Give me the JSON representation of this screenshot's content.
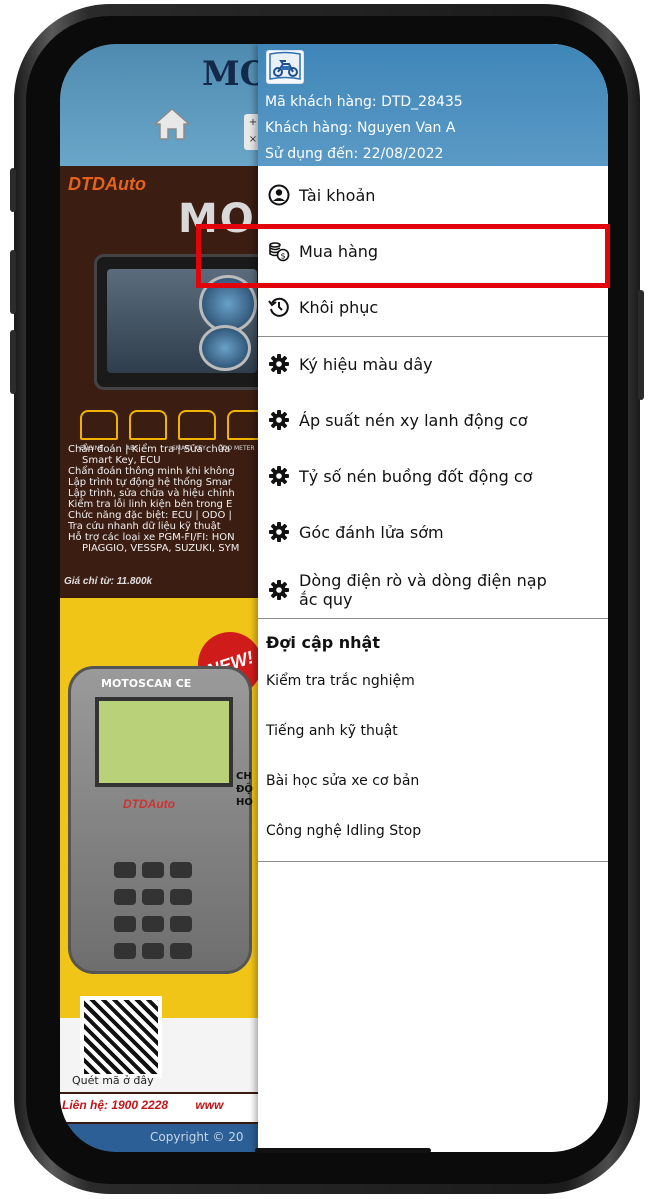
{
  "background_app": {
    "logo_text": "MO",
    "mini_buttons": [
      "+",
      "×"
    ],
    "brand": "DTDAuto",
    "banner_title": "MO",
    "icon_labels": [
      "ENGINE",
      "ABS",
      "SMART KEY",
      "ODO METER"
    ],
    "features": [
      "Chẩn đoán | Kiểm tra | Sửa chữa",
      "Smart Key, ECU",
      "Chẩn đoán thông minh khi không",
      "Lập trình tự động hệ thống Smar",
      "Lập trình, sửa chữa và hiệu chỉnh",
      "Kiểm tra lỗi linh kiện bên trong E",
      "Chức năng đặc biệt: ECU | ODO |",
      "Tra cứu nhanh dữ liệu kỹ thuật",
      "Hỗ trợ các loại xe PGM-FI/FI: HON",
      "PIAGGIO, VESSPA, SUZUKI, SYM"
    ],
    "price_text": "Giá chỉ từ: 11.800k",
    "new_badge": "NEW!",
    "device_label": "MOTOSCAN CE",
    "device_brand": "DTDAuto",
    "right_cut_text": [
      "CH",
      "ĐỘ",
      "HO"
    ],
    "qr_label": "Quét mã ở đây",
    "contact": "Liên hệ: 1900 2228",
    "contact_cut": "www",
    "footer": "Copyright © 20"
  },
  "drawer": {
    "header": {
      "customer_code": "Mã khách hàng: DTD_28435",
      "customer_name": "Khách hàng: Nguyen Van A",
      "valid_until": "Sử dụng đến: 22/08/2022"
    },
    "account_items": [
      {
        "label": "Tài khoản",
        "icon": "user-circle-icon"
      },
      {
        "label": "Mua hàng",
        "icon": "coins-dollar-icon"
      },
      {
        "label": "Khôi phục",
        "icon": "history-icon"
      }
    ],
    "tool_items": [
      {
        "label": "Ký hiệu màu dây",
        "icon": "gear-icon"
      },
      {
        "label": "Áp suất nén xy lanh động cơ",
        "icon": "gear-icon"
      },
      {
        "label": "Tỷ số nén buồng đốt động cơ",
        "icon": "gear-icon"
      },
      {
        "label": "Góc đánh lửa sớm",
        "icon": "gear-icon"
      },
      {
        "label": "Dòng điện rò và dòng điện nạp",
        "label_line2": "ắc quy",
        "icon": "gear-icon"
      }
    ],
    "section_title": "Đợi cập nhật",
    "pending_items": [
      "Kiểm tra trắc nghiệm",
      "Tiếng anh kỹ thuật",
      "Bài học sửa xe cơ bản",
      "Công nghệ Idling Stop"
    ]
  },
  "colors": {
    "drawer_header": "#4a8fbf",
    "highlight": "#e1050b",
    "footer": "#2b5f96"
  }
}
